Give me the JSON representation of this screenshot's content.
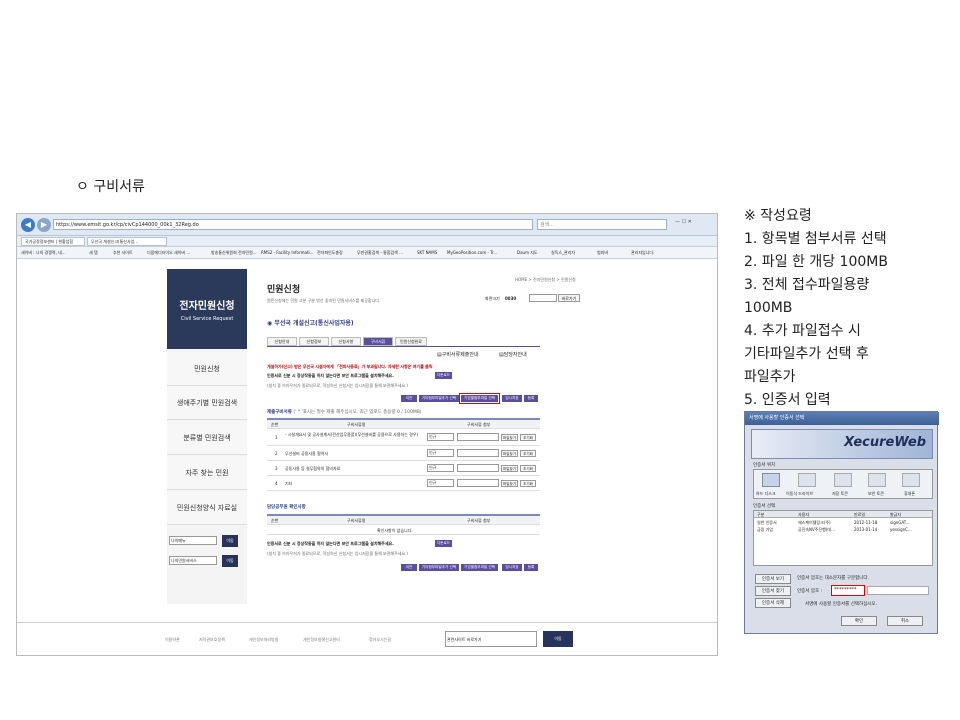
{
  "heading": "ㅇ 구비서류",
  "browser": {
    "address": "https://www.emsit.go.kr/cp/civCp144000_00k1_32Reg.do",
    "search_placeholder": "검색...",
    "tabs": [
      "국가공정정보센터 | 현황업힘",
      "무선국 개설신고(통신사업..."
    ],
    "favorites": [
      "새이버 : 나의 경쟁력, 네...",
      "새 탭",
      "추천 사이트",
      "디움에디터이오 새이버 ...",
      "방송통신위원회 전자민원...",
      "RMS2 - Facility Informati...",
      "전자파인도총장",
      "무판권홍검색 - 통합검색 ...",
      "SKT NAMS",
      "MyGeoPosition.com - Tr...",
      "Daum 지도",
      "실득스_관리자",
      "범죄바",
      "관리자입니다."
    ]
  },
  "sidebar": {
    "title": "전자민원신청",
    "subtitle": "Civil Service Request",
    "items": [
      "민원신청",
      "생애주기별 민원검색",
      "분류별 민원검색",
      "자주 찾는 민원",
      "민원신청양식 자료실"
    ],
    "select1": "나의메뉴",
    "select2": "나의민원서비스",
    "go": "이동"
  },
  "page": {
    "title": "민원신청",
    "desc": "원민신청에는 민원 고분 구분 방선 좋의된 민원서비스를 제공합니다.",
    "breadcrumb": "HOME > 전자민원신청 > 민원신청",
    "font_size_label": "화면크기",
    "font_size_value": "0030",
    "print": "바로가기",
    "section": "무선국 개설신고(통신사업자용)",
    "tabs": [
      "신청안내",
      "신청정보",
      "신청사항",
      "구비서류",
      "민원신청완료"
    ],
    "doc_guide": "구비서류제출안내",
    "contact": "담당자안내",
    "notice_red": "개설하가(신고) 받은 무선국 시설자에게 「전파사용료」가 부과됩니다. 자세한 사항은 여기를 클릭",
    "notice_black": "인증서로 신분 시 정상작동을 하지 않는다면 보안 프로그램을 설치해주세요.",
    "install": "다운로드",
    "notice_sub": "(설치 중 브라우저가 종료되므로, 작성하신 신청서는 임시저장을 통해 보관해주세요.)",
    "buttons": [
      "이전",
      "기타첨부파일추가 선택",
      "기업별첨부파일 선택",
      "임시저장",
      "등록"
    ],
    "docs_header": "제출구비서류",
    "docs_note": "(' * '표시는 필수 제출 해주십시오. 최근 업로드 총용량 0 / 100MB)",
    "docs_cols": [
      "순번",
      "구비서류명",
      "구비서류 첨부"
    ],
    "docs_rows": [
      {
        "no": "1",
        "name": "- 시설개요서 및 공사설계서(전산업무용품)(무선설비를 공용으로 사용하는 경우)"
      },
      {
        "no": "2",
        "name": "무선설비 공용사용 협약서"
      },
      {
        "no": "3",
        "name": "공동사용 등 설무협약의 협의자료"
      },
      {
        "no": "4",
        "name": "기타"
      }
    ],
    "doc_select": "인규",
    "find": "파일찾기",
    "delete": "초기화",
    "contact_header": "담당공무원 확인사항",
    "contact_cols": [
      "순번",
      "구비서류명",
      "구비서류 첨부"
    ],
    "contact_empty": "확인사항이 없습니다."
  },
  "footer": {
    "links": [
      "이용약관",
      "저작권보호정책",
      "개인정보처리방침",
      "개인정보침해신고센터",
      "찾아오시는길"
    ],
    "related": "관련사이트 바로가기",
    "go": "이동"
  },
  "steps": {
    "title": "※ 작성요령",
    "lines": [
      " 1. 항목별 첨부서류 선택",
      " 2. 파일 한 개당 100MB",
      " 3. 전체 접수파일용량",
      "100MB",
      " 4. 추가 파일접수 시",
      "기타파일추가 선택 후",
      "파일추가",
      " 5. 인증서 입력"
    ]
  },
  "cert": {
    "window_title": "서명에 사용할 인증서 선택",
    "brand": "XecureWeb",
    "location_label": "인증서 위치",
    "locations": [
      "하드 디스크",
      "이동식 드라이브",
      "저장 토큰",
      "보안 토큰",
      "휴대폰"
    ],
    "select_label": "인증서 선택",
    "cols": [
      "구분",
      "사용자",
      "만료일",
      "발급자"
    ],
    "rows": [
      {
        "type": "일반 인증서",
        "user": "헤스케이텔링크(주)",
        "exp": "2012-11-18",
        "issuer": "signGAT..."
      },
      {
        "type": "금융 기업",
        "user": "공진속NV주진행(대...",
        "exp": "2013-01-14",
        "issuer": "yessignC..."
      }
    ],
    "btn_view": "인증서 보기",
    "btn_find": "인증서 찾기",
    "btn_delete": "인증서 삭제",
    "case_msg": "인증서 암호는 대소문자를 구분합니다.",
    "pw_label": "인증서 암호 :",
    "pw_value": "*********",
    "info": "서명에 사용할 인증서를 선택하십시오.",
    "ok": "확인",
    "cancel": "취소"
  },
  "colors": {
    "accent": "#5a4e9e",
    "sidebar_head": "#2b3a5a",
    "highlight": "#e00000"
  }
}
